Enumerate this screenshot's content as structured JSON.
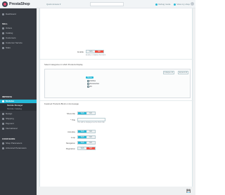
{
  "header": {
    "logo_text": "PrestaShop",
    "version": "1.7.x",
    "quick_access": "Quick Access ▾",
    "search_placeholder": "",
    "links": [
      "Debug mode",
      "View my shop"
    ]
  },
  "sidebar": {
    "items_top": [
      {
        "label": "Dashboard",
        "icon": "dashboard-icon"
      }
    ],
    "section_sell": "SELL",
    "items_sell": [
      {
        "label": "Orders",
        "icon": "cart-icon"
      },
      {
        "label": "Catalog",
        "icon": "store-icon"
      },
      {
        "label": "Customers",
        "icon": "person-icon"
      },
      {
        "label": "Customer Service",
        "icon": "chat-icon"
      },
      {
        "label": "Stats",
        "icon": "chart-icon"
      }
    ],
    "section_improve": "IMPROVE",
    "active_item": {
      "label": "Modules",
      "icon": "puzzle-icon"
    },
    "sub_items": [
      {
        "label": "Module Manager",
        "current": true
      },
      {
        "label": "Module Catalog",
        "current": false
      }
    ],
    "items_improve": [
      {
        "label": "Design",
        "icon": "desktop-icon"
      },
      {
        "label": "Shipping",
        "icon": "truck-icon"
      },
      {
        "label": "Payment",
        "icon": "card-icon"
      },
      {
        "label": "International",
        "icon": "globe-icon"
      }
    ],
    "section_configure": "CONFIGURE",
    "items_configure": [
      {
        "label": "Shop Parameters",
        "icon": "settings-icon"
      },
      {
        "label": "Advanced Parameters",
        "icon": "gear-icon"
      }
    ]
  },
  "form": {
    "top_toggle": {
      "label": "Enable",
      "yes": "YES",
      "no": "NO",
      "value": "no",
      "help": "Enable or disable this block"
    },
    "category_label": "Select Categories in which Products Display",
    "tree": {
      "collapse_label": "Collapse All",
      "expand_label": "Expand All",
      "root": "Home",
      "children": [
        "Clothes",
        "Accessories",
        "Art"
      ]
    },
    "section_title": "Featured Products Block on Homepage",
    "toggle_a": {
      "label": "Show title",
      "yes": "YES",
      "no": "NO",
      "value": "yes"
    },
    "title_input": {
      "label": "* Title",
      "value": "",
      "help": "This will be displayed as the block title"
    },
    "toggle_b": {
      "label": "Autoplay",
      "yes": "YES",
      "no": "NO",
      "value": "yes"
    },
    "toggle_c": {
      "label": "Loop",
      "yes": "YES",
      "no": "NO",
      "value": "yes"
    },
    "toggle_d": {
      "label": "Navigation",
      "yes": "YES",
      "no": "NO",
      "value": "yes"
    },
    "toggle_e": {
      "label": "Pagination",
      "yes": "YES",
      "no": "NO",
      "value": "no"
    },
    "save_icon": "save-icon"
  },
  "colors": {
    "accent": "#25b9d7",
    "danger": "#f54c3e",
    "sidebar": "#363a41"
  }
}
